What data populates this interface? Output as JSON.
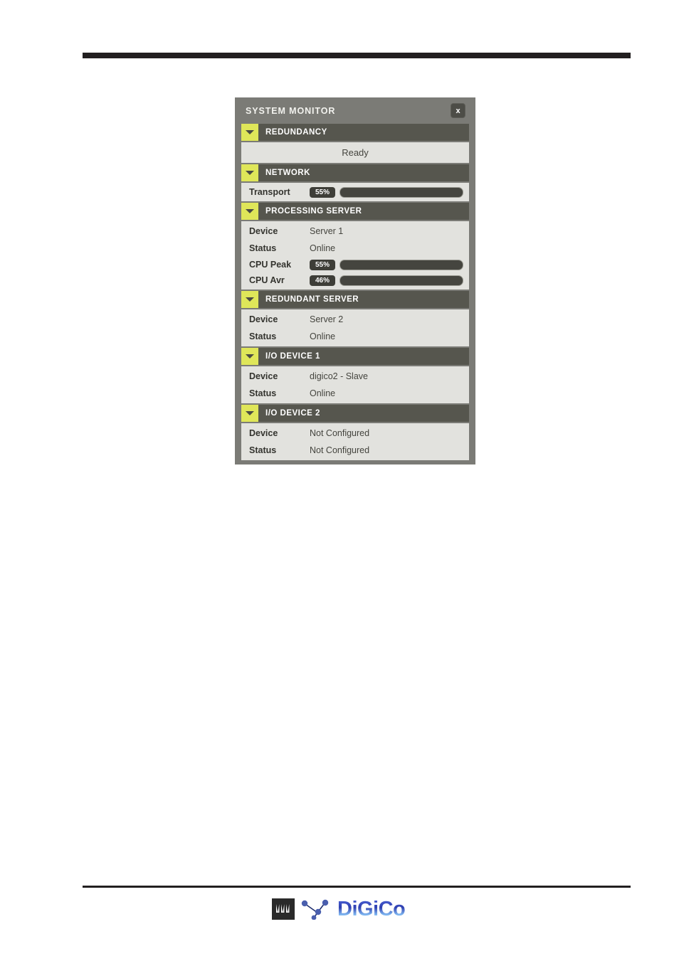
{
  "page": {
    "top_rule": true,
    "bottom_rule": true
  },
  "footer": {
    "logo_wordmark": "DiGiCo",
    "logo_mark": "waveform-icon",
    "logo_nodes": "network-nodes-icon"
  },
  "window": {
    "title": "SYSTEM MONITOR",
    "close_label": "x",
    "close_icon": "close-icon"
  },
  "colors": {
    "window_bg": "#7b7b76",
    "section_header_bg": "#56564e",
    "disclosure_yellow": "#dfe659",
    "content_bg": "#e2e2de",
    "meter_green": "#72c44e",
    "meter_track": "#45453f",
    "badge_bg": "#3e3e38"
  },
  "sections": [
    {
      "id": "redundancy",
      "title": "REDUNDANCY",
      "disclosure_icon": "chevron-down-icon",
      "expanded": true,
      "status_text": "Ready"
    },
    {
      "id": "network",
      "title": "NETWORK",
      "disclosure_icon": "chevron-down-icon",
      "expanded": true,
      "meters": [
        {
          "label": "Transport",
          "value": "55%",
          "percent": 55
        }
      ]
    },
    {
      "id": "processing-server",
      "title": "PROCESSING SERVER",
      "disclosure_icon": "chevron-down-icon",
      "expanded": true,
      "rows": [
        {
          "label": "Device",
          "value": "Server 1"
        },
        {
          "label": "Status",
          "value": "Online"
        }
      ],
      "meters": [
        {
          "label": "CPU Peak",
          "value": "55%",
          "percent": 55
        },
        {
          "label": "CPU Avr",
          "value": "46%",
          "percent": 46
        }
      ]
    },
    {
      "id": "redundant-server",
      "title": "REDUNDANT SERVER",
      "disclosure_icon": "chevron-down-icon",
      "expanded": true,
      "rows": [
        {
          "label": "Device",
          "value": "Server 2"
        },
        {
          "label": "Status",
          "value": "Online"
        }
      ]
    },
    {
      "id": "io-device-1",
      "title": "I/O DEVICE 1",
      "disclosure_icon": "chevron-down-icon",
      "expanded": true,
      "rows": [
        {
          "label": "Device",
          "value": "digico2 - Slave"
        },
        {
          "label": "Status",
          "value": "Online"
        }
      ]
    },
    {
      "id": "io-device-2",
      "title": "I/O DEVICE 2",
      "disclosure_icon": "chevron-down-icon",
      "expanded": true,
      "rows": [
        {
          "label": "Device",
          "value": "Not Configured"
        },
        {
          "label": "Status",
          "value": "Not Configured"
        }
      ]
    }
  ]
}
